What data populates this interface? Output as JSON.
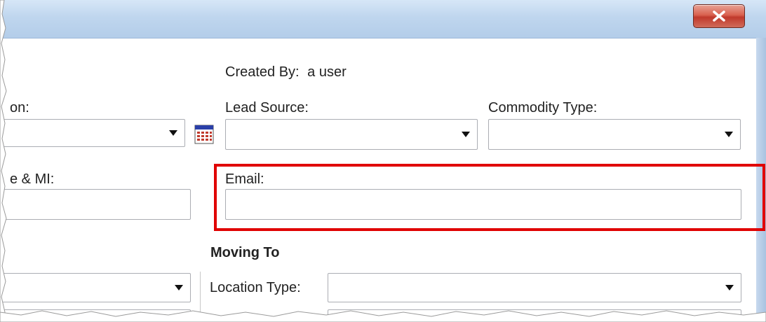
{
  "window": {
    "close_label": "X"
  },
  "form": {
    "created_by_label": "Created By:",
    "created_by_value": "a user",
    "col1_label": "on:",
    "lead_source_label": "Lead Source:",
    "commodity_type_label": "Commodity Type:",
    "name_label": "e & MI:",
    "email_label": "Email:",
    "email_value": "",
    "moving_to_heading": "Moving To",
    "location_type_label": "Location Type:"
  },
  "colors": {
    "highlight": "#e00000",
    "titlebar": "#bfd6ee",
    "close_button": "#c0392b"
  }
}
